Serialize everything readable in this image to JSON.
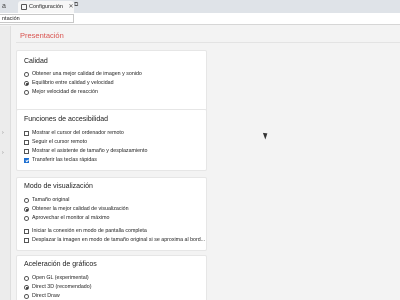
{
  "browser": {
    "left_tab_text": "a",
    "tab_title": "Configuración",
    "tab_close": "✕",
    "tab_extra": "⧉",
    "address_text": "ntación"
  },
  "page": {
    "section_title": "Presentación",
    "accent_color": "#d9534f"
  },
  "cards": {
    "calidad": {
      "title": "Calidad",
      "options": [
        {
          "label": "Obtener una mejor calidad de imagen y sonido",
          "checked": false
        },
        {
          "label": "Equilibrio entre calidad y velocidad",
          "checked": true
        },
        {
          "label": "Mejor velocidad de reacción",
          "checked": false
        }
      ]
    },
    "accesibilidad": {
      "title": "Funciones de accesibilidad",
      "options": [
        {
          "label": "Mostrar el cursor del ordenador remoto",
          "checked": false
        },
        {
          "label": "Seguir el cursor remoto",
          "checked": false
        },
        {
          "label": "Mostrar el asistente de tamaño y desplazamiento",
          "checked": false
        },
        {
          "label": "Transferir las teclas rápidas",
          "checked": true
        }
      ]
    },
    "visualizacion": {
      "title": "Modo de visualización",
      "radios": [
        {
          "label": "Tamaño original",
          "checked": false
        },
        {
          "label": "Obtener la mejor calidad de visualización",
          "checked": true
        },
        {
          "label": "Aprovechar el monitor al máximo",
          "checked": false
        }
      ],
      "checks": [
        {
          "label": "Iniciar la conexión en modo de pantalla completa",
          "checked": false
        },
        {
          "label": "Desplazar la imagen en modo de tamaño original si se aproxima al bord...",
          "checked": false
        }
      ]
    },
    "graficos": {
      "title": "Aceleración de gráficos",
      "options": [
        {
          "label": "Open GL (experimental)",
          "checked": false
        },
        {
          "label": "Direct 3D (recomendado)",
          "checked": true
        },
        {
          "label": "Direct Draw",
          "checked": false
        }
      ]
    }
  }
}
